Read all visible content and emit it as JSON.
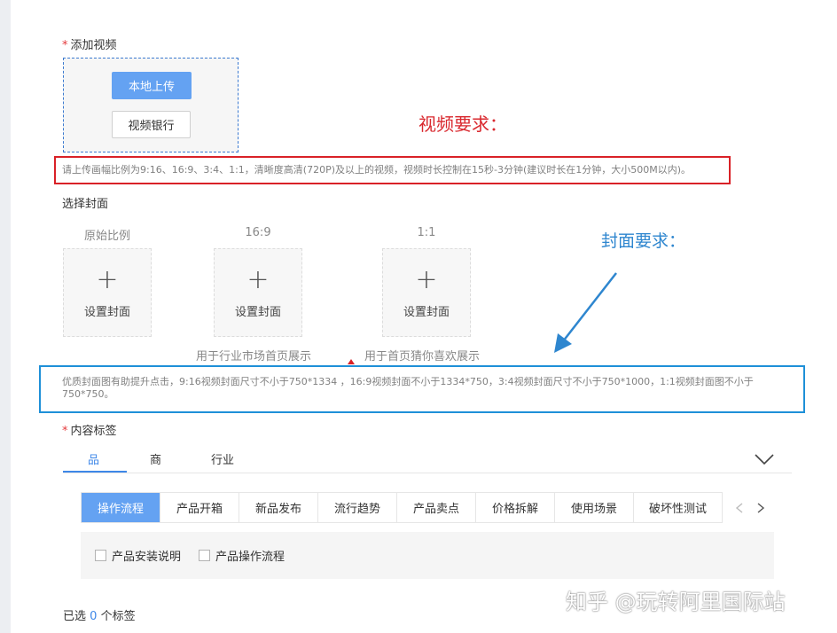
{
  "add_video": {
    "required_mark": "*",
    "label": "添加视频",
    "local_upload_label": "本地上传",
    "video_bank_label": "视频银行"
  },
  "annotations": {
    "video_requirements": "视频要求：",
    "cover_requirements": "封面要求："
  },
  "video_hint": "请上传画幅比例为9:16、16:9、3:4、1:1，清晰度高清(720P)及以上的视频，视频时长控制在15秒-3分钟(建议时长在1分钟，大小500M以内)。",
  "cover": {
    "label": "选择封面",
    "columns": [
      {
        "ratio": "原始比例",
        "action": "设置封面"
      },
      {
        "ratio": "16:9",
        "action": "设置封面",
        "note": "用于行业市场首页展示"
      },
      {
        "ratio": "1:1",
        "action": "设置封面",
        "note": "用于首页猜你喜欢展示"
      }
    ],
    "plus": "+",
    "hint": "优质封面图有助提升点击，9:16视频封面尺寸不小于750*1334 ，16:9视频封面不小于1334*750，3:4视频封面尺寸不小于750*1000，1:1视频封面图不小于750*750。"
  },
  "tags": {
    "required_mark": "*",
    "label": "内容标签",
    "tabs": [
      {
        "label": "品",
        "active": true
      },
      {
        "label": "商",
        "active": false
      },
      {
        "label": "行业",
        "active": false
      }
    ],
    "subtabs": [
      "操作流程",
      "产品开箱",
      "新品发布",
      "流行趋势",
      "产品卖点",
      "价格拆解",
      "使用场景",
      "破坏性测试"
    ],
    "active_subtab": "操作流程",
    "checkboxes": [
      "产品安装说明",
      "产品操作流程"
    ],
    "selected_prefix": "已选",
    "selected_count": "0",
    "selected_suffix": "个标签"
  },
  "watermark": "知乎 @玩转阿里国际站",
  "colors": {
    "primary": "#64a2f2",
    "link": "#3e87e8",
    "annotation_red": "#d92127",
    "annotation_blue": "#1e90d8"
  }
}
